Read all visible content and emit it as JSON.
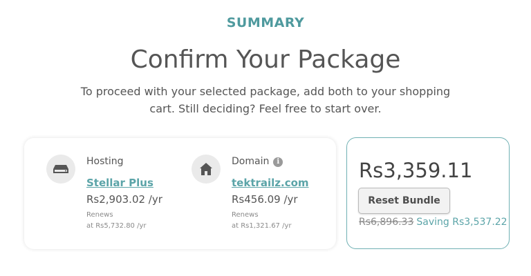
{
  "header": {
    "kicker": "SUMMARY",
    "title": "Confirm Your Package",
    "subtitle": "To proceed with your selected package, add both to your shopping cart. Still deciding? Feel free to start over."
  },
  "package": {
    "hosting": {
      "label": "Hosting",
      "name": "Stellar Plus",
      "price": "Rs2,903.02 /yr",
      "renews_label": "Renews",
      "renews_price": "at Rs5,732.80 /yr",
      "icon": "server-icon"
    },
    "domain": {
      "label": "Domain",
      "name": "tektrailz.com",
      "price": "Rs456.09 /yr",
      "renews_label": "Renews",
      "renews_price": "at Rs1,321.67 /yr",
      "icon": "house-icon",
      "info_icon": "info-icon"
    }
  },
  "bundle": {
    "total": "Rs3,359.11",
    "reset_label": "Reset Bundle",
    "original_price": "Rs6,896.33",
    "saving_text": "Saving Rs3,537.22"
  },
  "colors": {
    "accent": "#5ba4a8",
    "kicker": "#4f9a9e",
    "card_border": "#6fb0b3"
  }
}
